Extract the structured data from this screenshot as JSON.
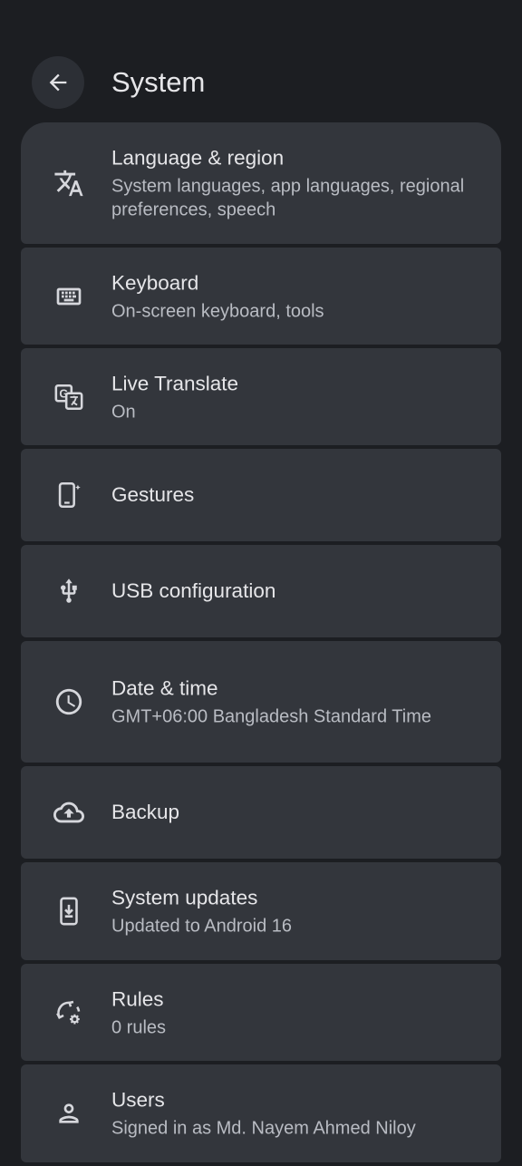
{
  "header": {
    "title": "System",
    "back_icon": "arrow-back-icon"
  },
  "colors": {
    "background": "#1c1e22",
    "card": "#33363c",
    "back_button": "#2c2f35",
    "title_text": "#e6e6e9",
    "subtitle_text": "#b9bcc3"
  },
  "items": [
    {
      "key": "language",
      "title": "Language & region",
      "subtitle": "System languages, app languages, regional preferences, speech",
      "icon": "translate-icon"
    },
    {
      "key": "keyboard",
      "title": "Keyboard",
      "subtitle": "On-screen keyboard, tools",
      "icon": "keyboard-icon"
    },
    {
      "key": "live-translate",
      "title": "Live Translate",
      "subtitle": "On",
      "icon": "google-translate-icon"
    },
    {
      "key": "gestures",
      "title": "Gestures",
      "subtitle": "",
      "icon": "gesture-phone-icon"
    },
    {
      "key": "usb",
      "title": "USB configuration",
      "subtitle": "",
      "icon": "usb-icon"
    },
    {
      "key": "date-time",
      "title": "Date & time",
      "subtitle": "GMT+06:00 Bangladesh Standard Time",
      "icon": "clock-icon"
    },
    {
      "key": "backup",
      "title": "Backup",
      "subtitle": "",
      "icon": "cloud-upload-icon"
    },
    {
      "key": "system-updates",
      "title": "System updates",
      "subtitle": "Updated to Android 16",
      "icon": "system-update-icon"
    },
    {
      "key": "rules",
      "title": "Rules",
      "subtitle": "0 rules",
      "icon": "rules-icon"
    },
    {
      "key": "users",
      "title": "Users",
      "subtitle": "Signed in as Md. Nayem Ahmed Niloy",
      "icon": "person-icon"
    }
  ]
}
